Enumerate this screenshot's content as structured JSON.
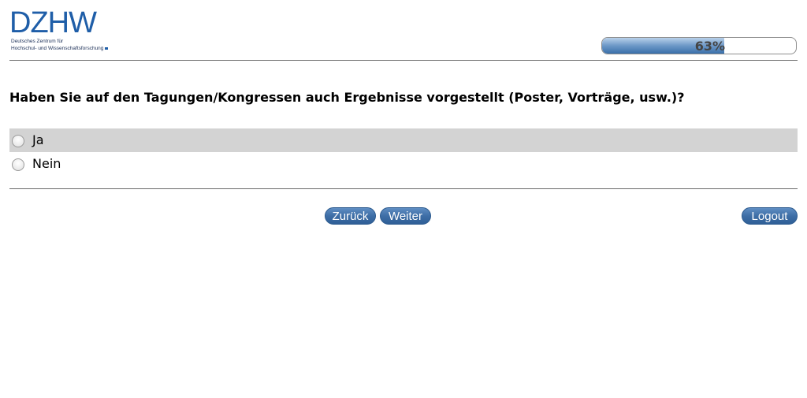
{
  "header": {
    "logo": {
      "main": "DZHW",
      "sub_line1": "Deutsches Zentrum für",
      "sub_line2": "Hochschul- und Wissenschaftsforschung"
    },
    "progress": {
      "value": 0.63,
      "label": "63%"
    }
  },
  "question": {
    "text": "Haben Sie auf den Tagungen/Kongressen auch Ergebnisse vorgestellt (Poster, Vorträge, usw.)?",
    "options": [
      {
        "label": "Ja",
        "selected": false
      },
      {
        "label": "Nein",
        "selected": false
      }
    ]
  },
  "nav": {
    "back_label": "Zurück",
    "next_label": "Weiter",
    "logout_label": "Logout"
  },
  "colors": {
    "brand": "#1f5ea8",
    "button": "#3e6ea6",
    "highlight_row": "#d3d3d3"
  }
}
